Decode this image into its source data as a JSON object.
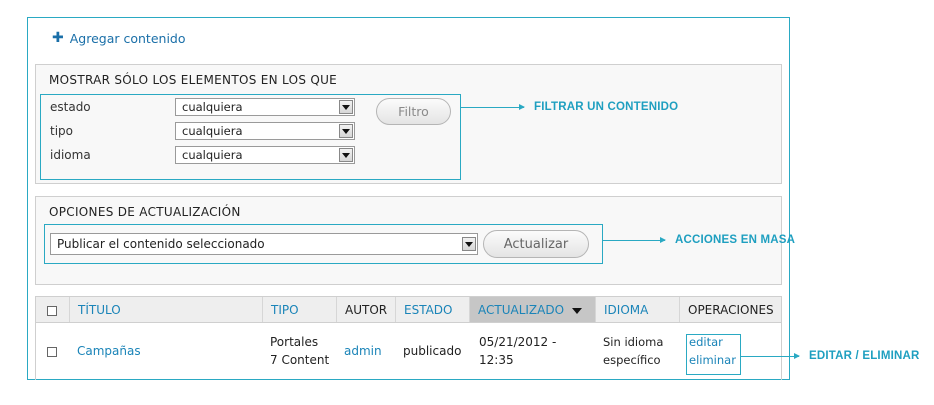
{
  "add_content": {
    "icon": "plus-icon",
    "label": "Agregar contenido"
  },
  "filter": {
    "legend": "MOSTRAR SÓLO LOS ELEMENTOS EN LOS QUE",
    "rows": [
      {
        "label": "estado",
        "value": "cualquiera"
      },
      {
        "label": "tipo",
        "value": "cualquiera"
      },
      {
        "label": "idioma",
        "value": "cualquiera"
      }
    ],
    "button": "Filtro",
    "callout": "FILTRAR UN CONTENIDO"
  },
  "update": {
    "legend": "OPCIONES DE ACTUALIZACIÓN",
    "action_value": "Publicar el contenido seleccionado",
    "button": "Actualizar",
    "callout": "ACCIONES EN MASA"
  },
  "table": {
    "headers": {
      "title": "TÍTULO",
      "type": "TIPO",
      "author": "AUTOR",
      "status": "ESTADO",
      "updated": "ACTUALIZADO",
      "language": "IDIOMA",
      "operations": "OPERACIONES"
    },
    "row": {
      "title": "Campañas",
      "type_line1": "Portales",
      "type_line2": "7 Content",
      "author": "admin",
      "status": "publicado",
      "updated_line1": "05/21/2012 -",
      "updated_line2": "12:35",
      "language_line1": "Sin idioma",
      "language_line2": "específico",
      "edit": "editar",
      "delete": "eliminar"
    },
    "callout": "EDITAR / ELIMINAR"
  },
  "colors": {
    "accent": "#2aa9c3",
    "link": "#1a84b8",
    "callout_text": "#1e9fc0"
  }
}
